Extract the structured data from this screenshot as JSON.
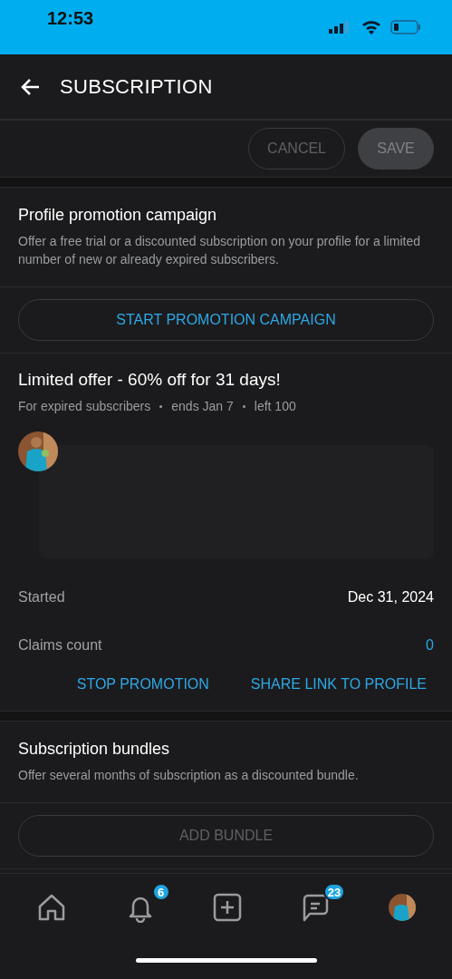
{
  "status_bar": {
    "time": "12:53"
  },
  "header": {
    "title": "SUBSCRIPTION"
  },
  "actions": [
    {
      "label": "CANCEL",
      "kind": "outline",
      "disabled": true
    },
    {
      "label": "SAVE",
      "kind": "filled",
      "disabled": true
    }
  ],
  "promotion": {
    "title": "Profile promotion campaign",
    "description": "Offer a free trial or a discounted subscription on your profile for a limited number of new or already expired subscribers.",
    "button": "START PROMOTION CAMPAIGN"
  },
  "offer": {
    "title": "Limited offer - 60% off for 31 days!",
    "meta": [
      "For expired subscribers",
      "ends Jan 7",
      "left 100"
    ],
    "rows": [
      {
        "label": "Started",
        "value": "Dec 31, 2024",
        "kind": "plain"
      },
      {
        "label": "Claims count",
        "value": "0",
        "kind": "link"
      }
    ],
    "links": [
      "STOP PROMOTION",
      "SHARE LINK TO PROFILE"
    ]
  },
  "bundles": {
    "title": "Subscription bundles",
    "description": "Offer several months of subscription as a discounted bundle.",
    "button": "ADD BUNDLE",
    "disabled": true
  },
  "nav": [
    {
      "kind": "home"
    },
    {
      "kind": "bell",
      "badge": "6"
    },
    {
      "kind": "add"
    },
    {
      "kind": "chat",
      "badge": "23"
    },
    {
      "kind": "avatar"
    }
  ]
}
